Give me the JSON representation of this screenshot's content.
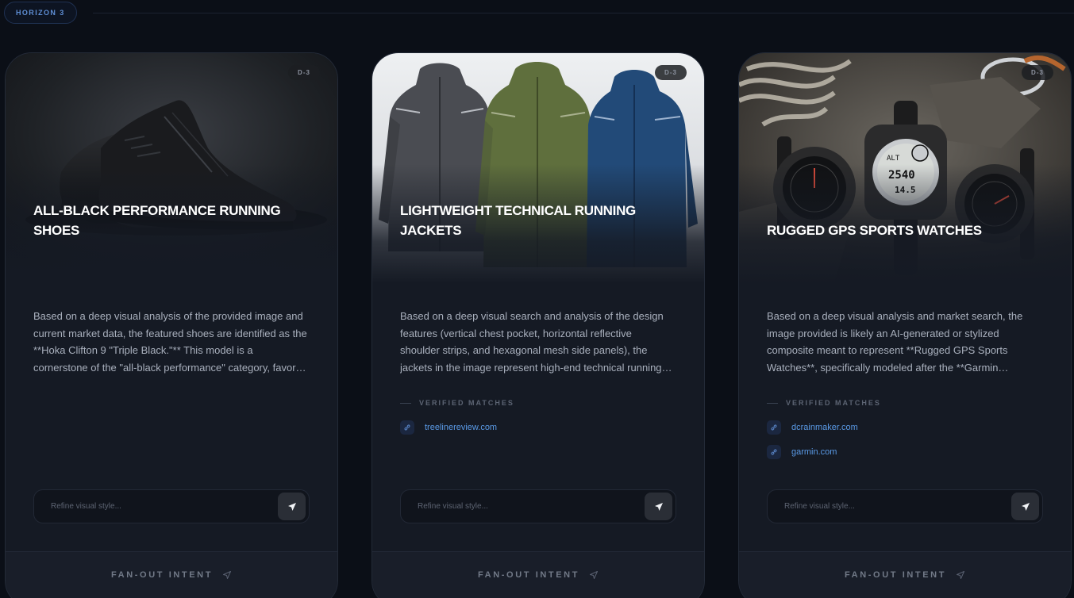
{
  "horizon": {
    "label": "HORIZON 3"
  },
  "cards": [
    {
      "badge": "D-3",
      "title": "ALL-BLACK PERFORMANCE RUNNING SHOES",
      "description": "Based on a deep visual analysis of the provided image and current market data, the featured shoes are identified as the **Hoka Clifton 9 \"Triple Black.\"** This model is a cornerstone of the \"all-black performance\" category, favored by runners who want a clean, understated look.",
      "matches_label": "",
      "links": [],
      "refine_placeholder": "Refine visual style...",
      "footer_label": "FAN-OUT INTENT"
    },
    {
      "badge": "D-3",
      "title": "LIGHTWEIGHT TECHNICAL RUNNING JACKETS",
      "description": "Based on a deep visual search and analysis of the design features (vertical chest pocket, horizontal reflective shoulder strips, and hexagonal mesh side panels), the jackets in the image represent high-end technical running shells designed for wind and light rain.",
      "matches_label": "VERIFIED MATCHES",
      "links": [
        "treelinereview.com"
      ],
      "refine_placeholder": "Refine visual style...",
      "footer_label": "FAN-OUT INTENT"
    },
    {
      "badge": "D-3",
      "title": "RUGGED GPS SPORTS WATCHES",
      "description": "Based on a deep visual analysis and market search, the image provided is likely an AI-generated or stylized composite meant to represent **Rugged GPS Sports Watches**, specifically modeled after the **Garmin Instinct** line of outdoor watches.",
      "matches_label": "VERIFIED MATCHES",
      "links": [
        "dcrainmaker.com",
        "garmin.com"
      ],
      "refine_placeholder": "Refine visual style...",
      "footer_label": "FAN-OUT INTENT"
    }
  ],
  "colors": {
    "accent": "#5a9ae6",
    "background": "#0b0f17",
    "card": "#151a24"
  },
  "icons": {
    "send": "send-icon",
    "link": "link-icon",
    "fanout": "paper-plane-icon"
  }
}
